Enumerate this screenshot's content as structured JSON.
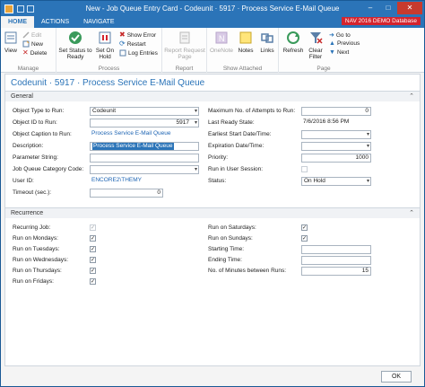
{
  "window": {
    "title": "New - Job Queue Entry Card - Codeunit · 5917 · Process Service E-Mail Queue"
  },
  "tabs": [
    {
      "label": "HOME"
    },
    {
      "label": "ACTIONS"
    },
    {
      "label": "NAVIGATE"
    }
  ],
  "badge": "NAV 2016 DEMO Database",
  "ribbon": {
    "manage": {
      "label": "Manage",
      "view": "View",
      "edit": "Edit",
      "new": "New",
      "delete": "Delete"
    },
    "process": {
      "label": "Process",
      "set_ready": "Set Status to Ready",
      "set_hold": "Set On Hold",
      "show_error": "Show Error",
      "restart": "Restart",
      "log_entries": "Log Entries"
    },
    "report": {
      "label": "Report",
      "request_page": "Report Request Page"
    },
    "attached": {
      "label": "Show Attached",
      "onenote": "OneNote",
      "notes": "Notes",
      "links": "Links"
    },
    "page": {
      "label": "Page",
      "refresh": "Refresh",
      "clear_filter": "Clear Filter",
      "goto": "Go to",
      "previous": "Previous",
      "next": "Next"
    }
  },
  "page_title": "Codeunit · 5917 · Process Service E-Mail Queue",
  "general": {
    "header": "General",
    "object_type_label": "Object Type to Run:",
    "object_type_value": "Codeunit",
    "object_id_label": "Object ID to Run:",
    "object_id_value": "5917",
    "object_caption_label": "Object Caption to Run:",
    "object_caption_value": "Process Service E-Mail Queue",
    "description_label": "Description:",
    "description_value": "Process Service E-Mail Queue",
    "parameter_label": "Parameter String:",
    "parameter_value": "",
    "category_label": "Job Queue Category Code:",
    "category_value": "",
    "user_id_label": "User ID:",
    "user_id_value": "ENCORE2\\THEMY",
    "timeout_label": "Timeout (sec.):",
    "timeout_value": "0",
    "max_attempts_label": "Maximum No. of Attempts to Run:",
    "max_attempts_value": "0",
    "last_ready_label": "Last Ready State:",
    "last_ready_value": "7/6/2016 8:56 PM",
    "earliest_start_label": "Earliest Start Date/Time:",
    "earliest_start_value": "",
    "expiration_label": "Expiration Date/Time:",
    "expiration_value": "",
    "priority_label": "Priority:",
    "priority_value": "1000",
    "run_in_session_label": "Run in User Session:",
    "status_label": "Status:",
    "status_value": "On Hold"
  },
  "recurrence": {
    "header": "Recurrence",
    "recurring_label": "Recurring Job:",
    "mon_label": "Run on Mondays:",
    "tue_label": "Run on Tuesdays:",
    "wed_label": "Run on Wednesdays:",
    "thu_label": "Run on Thursdays:",
    "fri_label": "Run on Fridays:",
    "sat_label": "Run on Saturdays:",
    "sun_label": "Run on Sundays:",
    "start_time_label": "Starting Time:",
    "start_time_value": "",
    "end_time_label": "Ending Time:",
    "end_time_value": "",
    "minutes_label": "No. of Minutes between Runs:",
    "minutes_value": "15",
    "checks": {
      "recurring": true,
      "mon": true,
      "tue": true,
      "wed": true,
      "thu": true,
      "fri": true,
      "sat": true,
      "sun": true
    }
  },
  "footer": {
    "ok": "OK"
  },
  "colors": {
    "accent": "#2b74b8",
    "badge": "#d4242e",
    "link": "#1d64b3"
  }
}
